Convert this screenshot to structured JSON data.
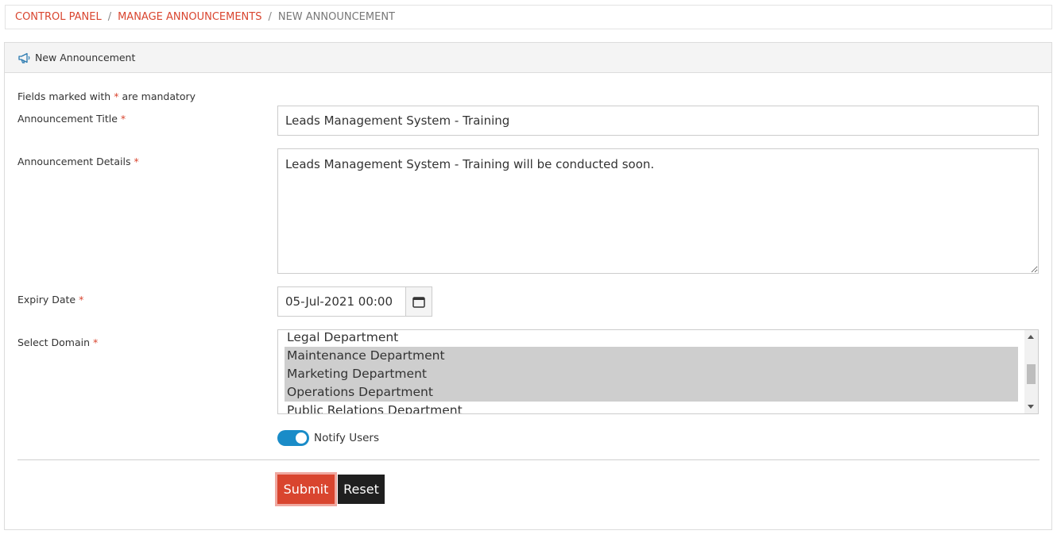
{
  "breadcrumb": {
    "items": [
      "CONTROL PANEL",
      "MANAGE ANNOUNCEMENTS",
      "NEW ANNOUNCEMENT"
    ],
    "separator": "/"
  },
  "card": {
    "header_icon": "megaphone-icon",
    "header_title": "New Announcement"
  },
  "form": {
    "mandatory_note_prefix": "Fields marked with",
    "mandatory_note_star": "*",
    "mandatory_note_suffix": "are mandatory",
    "required_marker": "*",
    "title_label": "Announcement Title",
    "title_value": "Leads Management System - Training",
    "details_label": "Announcement Details",
    "details_value": "Leads Management System - Training will be conducted soon.",
    "expiry_label": "Expiry Date",
    "expiry_value": "05-Jul-2021 00:00",
    "expiry_icon": "calendar-icon",
    "domain_label": "Select Domain",
    "domain_options": [
      {
        "label": "Legal Department",
        "selected": false
      },
      {
        "label": "Maintenance Department",
        "selected": true
      },
      {
        "label": "Marketing Department",
        "selected": true
      },
      {
        "label": "Operations Department",
        "selected": true
      },
      {
        "label": "Public Relations Department",
        "selected": false
      }
    ],
    "notify_label": "Notify Users",
    "notify_on": true,
    "submit_label": "Submit",
    "reset_label": "Reset"
  },
  "colors": {
    "accent": "#d9452f",
    "toggle": "#1a8cc8",
    "reset_button": "#1f1f1f"
  }
}
